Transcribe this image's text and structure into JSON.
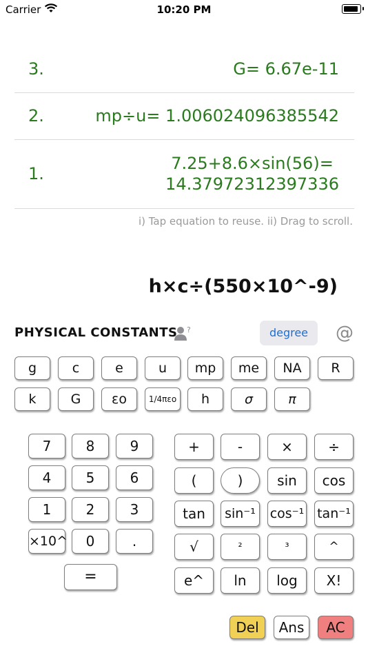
{
  "status": {
    "carrier": "Carrier",
    "time": "10:20 PM"
  },
  "history": [
    {
      "num": "3.",
      "lines": [
        "G= 6.67e-11"
      ]
    },
    {
      "num": "2.",
      "lines": [
        "mp÷u= 1.006024096385542"
      ]
    },
    {
      "num": "1.",
      "lines": [
        "7.25+8.6×sin(56)=",
        "14.37972312397336"
      ]
    }
  ],
  "hint": "i) Tap equation to reuse. ii) Drag to scroll.",
  "expression": "h×c÷(550×10^-9)",
  "constants_header": {
    "title": "PHYSICAL CONSTANTS",
    "degree": "degree",
    "at": "@"
  },
  "constants": [
    "g",
    "c",
    "e",
    "u",
    "mp",
    "me",
    "NA",
    "R",
    "k",
    "G",
    "εo",
    "1/4πεo",
    "h",
    "σ",
    "π"
  ],
  "numpad": [
    "7",
    "8",
    "9",
    "4",
    "5",
    "6",
    "1",
    "2",
    "3",
    "×10^",
    "0",
    ".",
    "="
  ],
  "operators": [
    "+",
    "-",
    "×",
    "÷",
    "(",
    ")",
    "sin",
    "cos",
    "tan",
    "sin⁻¹",
    "cos⁻¹",
    "tan⁻¹",
    "√",
    "²",
    "³",
    "^",
    "e^",
    "ln",
    "log",
    "X!"
  ],
  "bottom": {
    "del": "Del",
    "ans": "Ans",
    "ac": "AC"
  },
  "icons": {
    "wifi": "wifi-icon",
    "battery": "battery-icon",
    "person": "person-question-icon"
  }
}
